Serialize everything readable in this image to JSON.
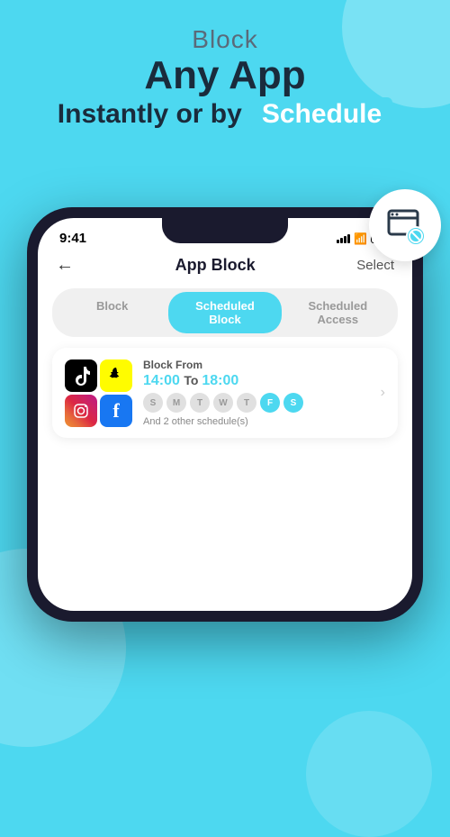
{
  "background_color": "#4DD8F0",
  "header": {
    "line1": "Block",
    "line2": "Any App",
    "line3_prefix": "Instantly or by",
    "line3_highlight": "Schedule"
  },
  "floating_badge": {
    "aria": "block-icon"
  },
  "phone": {
    "status_bar": {
      "time": "9:41",
      "signal": "active",
      "wifi": true,
      "battery": 80
    },
    "nav": {
      "back_label": "←",
      "title": "App Block",
      "select_label": "Select"
    },
    "tabs": [
      {
        "label": "Block",
        "active": false
      },
      {
        "label": "Scheduled\nBlock",
        "active": true
      },
      {
        "label": "Scheduled\nAccess",
        "active": false
      }
    ],
    "schedule_card": {
      "block_from_label": "Block From",
      "time_start": "14:00",
      "time_to": "To",
      "time_end": "18:00",
      "days": [
        "S",
        "M",
        "T",
        "W",
        "T",
        "F",
        "S"
      ],
      "active_days": [
        5,
        6
      ],
      "other_schedules": "And 2 other schedule(s)",
      "apps": [
        {
          "name": "TikTok",
          "type": "tiktok"
        },
        {
          "name": "Snapchat",
          "type": "snapchat"
        },
        {
          "name": "Instagram",
          "type": "instagram"
        },
        {
          "name": "Facebook",
          "type": "facebook"
        }
      ]
    }
  }
}
